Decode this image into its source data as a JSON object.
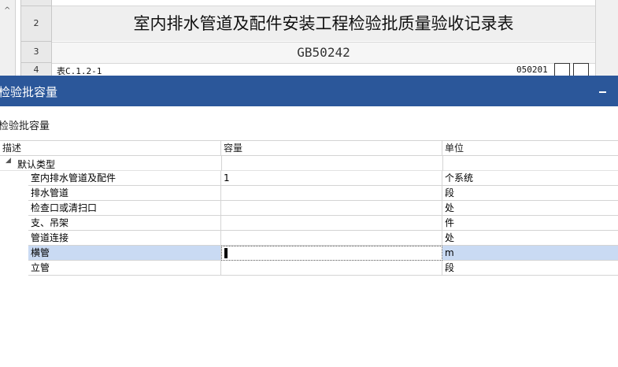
{
  "sheet": {
    "row_numbers": [
      "2",
      "3",
      "4"
    ],
    "title": "室内排水管道及配件安装工程检验批质量验收记录表",
    "standard_code": "GB50242",
    "form_ref": "表C.1.2-1",
    "form_number": "050201"
  },
  "dialog": {
    "title": "检验批容量",
    "subtitle": "检验批容量",
    "columns": {
      "description": "描述",
      "capacity": "容量",
      "unit": "单位"
    },
    "group": {
      "label": "默认类型",
      "expanded": true
    },
    "rows": [
      {
        "description": "室内排水管道及配件",
        "capacity": "1",
        "unit": "个系统"
      },
      {
        "description": "排水管道",
        "capacity": "",
        "unit": "段"
      },
      {
        "description": "检查口或清扫口",
        "capacity": "",
        "unit": "处"
      },
      {
        "description": "支、吊架",
        "capacity": "",
        "unit": "件"
      },
      {
        "description": "管道连接",
        "capacity": "",
        "unit": "处"
      },
      {
        "description": "横管",
        "capacity": "",
        "unit": "m",
        "selected": true
      },
      {
        "description": "立管",
        "capacity": "",
        "unit": "段"
      }
    ]
  },
  "colors": {
    "titlebar": "#2b579a",
    "selection": "#c9daf3"
  },
  "icons": {
    "minimize": "minimize-icon",
    "expand": "expand-triangle-icon",
    "scroll_up": "scroll-up-icon"
  }
}
